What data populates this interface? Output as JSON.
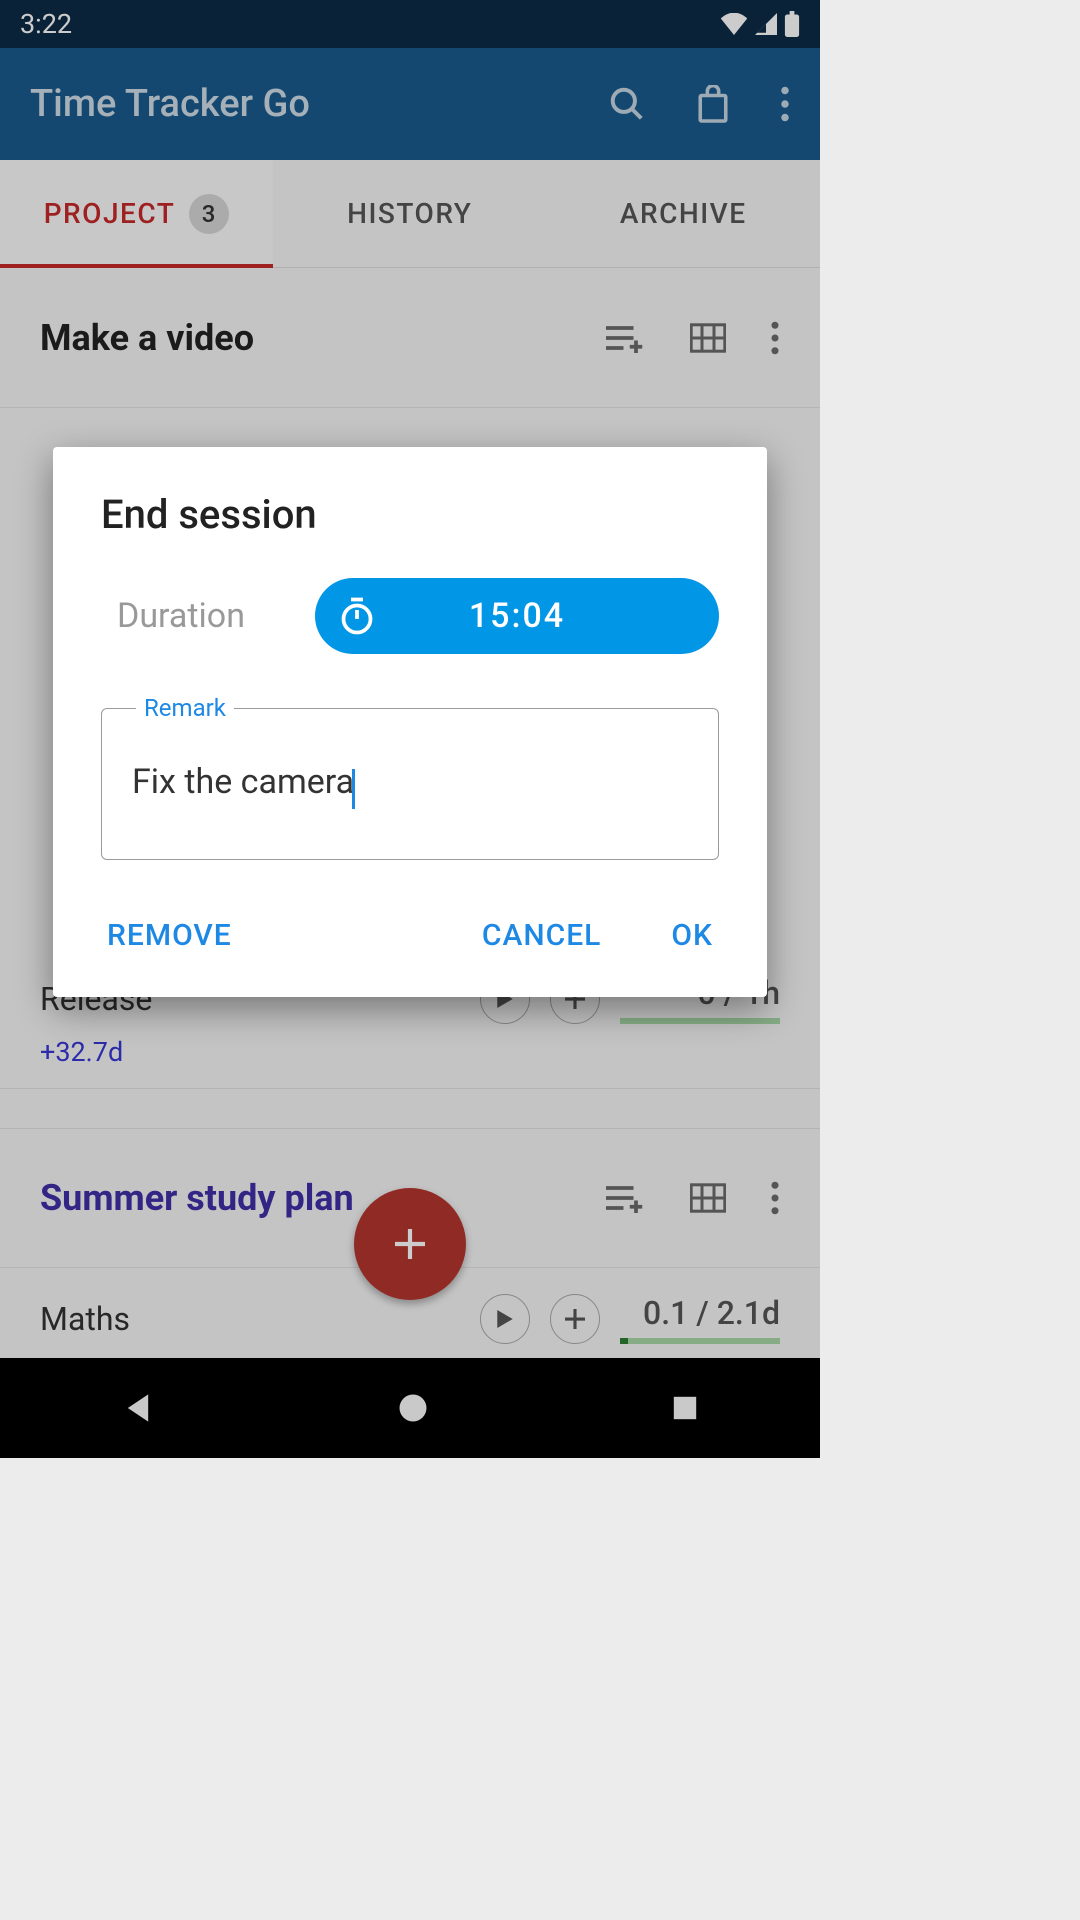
{
  "status": {
    "time": "3:22"
  },
  "appbar": {
    "title": "Time Tracker Go"
  },
  "tabs": {
    "project": "PROJECT",
    "project_count": "3",
    "history": "HISTORY",
    "archive": "ARCHIVE"
  },
  "projects": [
    {
      "title": "Make a video",
      "tasks": [
        {
          "label": "Release",
          "offset": "+32.7d",
          "stat": "0 / 1h"
        }
      ]
    },
    {
      "title": "Summer study plan",
      "title_class": "purple",
      "tasks": [
        {
          "label": "Maths",
          "stat": "0.1 / 2.1d"
        }
      ]
    }
  ],
  "dialog": {
    "title": "End session",
    "duration_label": "Duration",
    "duration_value": "15:04",
    "remark_label": "Remark",
    "remark_value": "Fix the camera",
    "remove": "REMOVE",
    "cancel": "CANCEL",
    "ok": "OK"
  }
}
